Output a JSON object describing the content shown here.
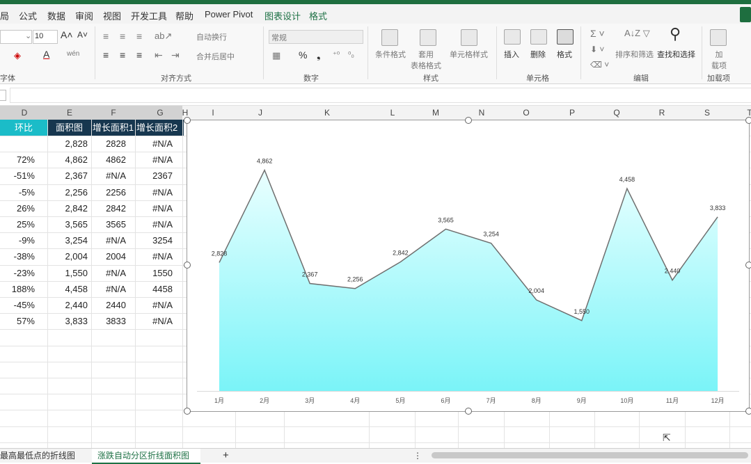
{
  "menu": {
    "items": [
      "局",
      "公式",
      "数据",
      "审阅",
      "视图",
      "开发工具",
      "帮助",
      "Power Pivot",
      "图表设计",
      "格式"
    ]
  },
  "ribbon": {
    "font_size": "10",
    "wrap_text": "自动换行",
    "merge_center": "合并后居中",
    "number_format": "常规",
    "conditional_format": "条件格式",
    "table_format": "套用\n表格格式",
    "cell_style": "单元格样式",
    "insert": "插入",
    "delete": "删除",
    "format": "格式",
    "sort_filter": "排序和筛选",
    "find_select": "查找和选择",
    "addins": "加\n载项",
    "groups": [
      "字体",
      "对齐方式",
      "数字",
      "样式",
      "单元格",
      "编辑",
      "加载项"
    ]
  },
  "columns": [
    "D",
    "E",
    "F",
    "G",
    "H",
    "I",
    "J",
    "K",
    "L",
    "M",
    "N",
    "O",
    "P",
    "Q",
    "R",
    "S",
    "T"
  ],
  "table": {
    "headers": [
      "环比",
      "面积图",
      "增长面积1",
      "增长面积2"
    ],
    "rows": [
      [
        "",
        "2,828",
        "2828",
        "#N/A"
      ],
      [
        "72%",
        "4,862",
        "4862",
        "#N/A"
      ],
      [
        "-51%",
        "2,367",
        "#N/A",
        "2367"
      ],
      [
        "-5%",
        "2,256",
        "2256",
        "#N/A"
      ],
      [
        "26%",
        "2,842",
        "2842",
        "#N/A"
      ],
      [
        "25%",
        "3,565",
        "3565",
        "#N/A"
      ],
      [
        "-9%",
        "3,254",
        "#N/A",
        "3254"
      ],
      [
        "-38%",
        "2,004",
        "2004",
        "#N/A"
      ],
      [
        "-23%",
        "1,550",
        "#N/A",
        "1550"
      ],
      [
        "188%",
        "4,458",
        "#N/A",
        "4458"
      ],
      [
        "-45%",
        "2,440",
        "2440",
        "#N/A"
      ],
      [
        "57%",
        "3,833",
        "3833",
        "#N/A"
      ]
    ]
  },
  "chart_data": {
    "type": "area",
    "categories": [
      "1月",
      "2月",
      "3月",
      "4月",
      "5月",
      "6月",
      "7月",
      "8月",
      "9月",
      "10月",
      "11月",
      "12月"
    ],
    "values": [
      2828,
      4862,
      2367,
      2256,
      2842,
      3565,
      3254,
      2004,
      1550,
      4458,
      2440,
      3833
    ],
    "data_labels": [
      "2,828",
      "4,862",
      "2,367",
      "2,256",
      "2,842",
      "3,565",
      "3,254",
      "2,004",
      "1,550",
      "4,458",
      "2,440",
      "3,833"
    ],
    "ylim": [
      0,
      5500
    ],
    "grid": false,
    "legend": "none",
    "fill_gradient": [
      "#7af4f8",
      "#eaffff"
    ],
    "line_color": "#6f6f6f"
  },
  "sheet_tabs": {
    "tab1": "最高最低点的折线图",
    "tab2": "涨跌自动分区折线面积图",
    "add": "+",
    "more": "⋮"
  },
  "colors": {
    "accent": "#1e7145",
    "header_dark": "#17374f",
    "header_teal": "#1bbcc8"
  }
}
